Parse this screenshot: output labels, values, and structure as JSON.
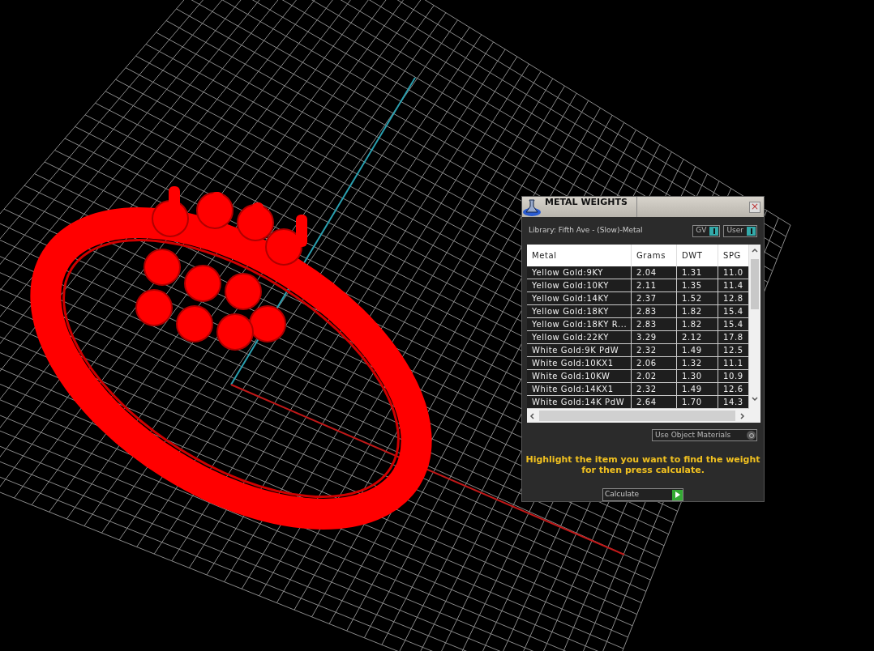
{
  "dialog": {
    "title": "METAL WEIGHTS",
    "close": "×",
    "library": "Library: Fifth Ave - (Slow)-Metal",
    "toggles": [
      {
        "label": "GV",
        "on": true
      },
      {
        "label": "User",
        "on": true
      }
    ],
    "table": {
      "columns": [
        "Metal",
        "Grams",
        "DWT",
        "SPG"
      ],
      "rows": [
        [
          "Yellow Gold:9KY",
          "2.04",
          "1.31",
          "11.0"
        ],
        [
          "Yellow Gold:10KY",
          "2.11",
          "1.35",
          "11.4"
        ],
        [
          "Yellow Gold:14KY",
          "2.37",
          "1.52",
          "12.8"
        ],
        [
          "Yellow Gold:18KY",
          "2.83",
          "1.82",
          "15.4"
        ],
        [
          "Yellow Gold:18KY R...",
          "2.83",
          "1.82",
          "15.4"
        ],
        [
          "Yellow Gold:22KY",
          "3.29",
          "2.12",
          "17.8"
        ],
        [
          "White Gold:9K PdW",
          "2.32",
          "1.49",
          "12.5"
        ],
        [
          "White Gold:10KX1",
          "2.06",
          "1.32",
          "11.1"
        ],
        [
          "White Gold:10KW",
          "2.02",
          "1.30",
          "10.9"
        ],
        [
          "White Gold:14KX1",
          "2.32",
          "1.49",
          "12.6"
        ],
        [
          "White Gold:14K PdW",
          "2.64",
          "1.70",
          "14.3"
        ]
      ]
    },
    "object_materials": {
      "label": "Use Object Materials",
      "on": false
    },
    "hint": "Highlight the item you want to find the weight for then press calculate.",
    "calculate": "Calculate"
  }
}
